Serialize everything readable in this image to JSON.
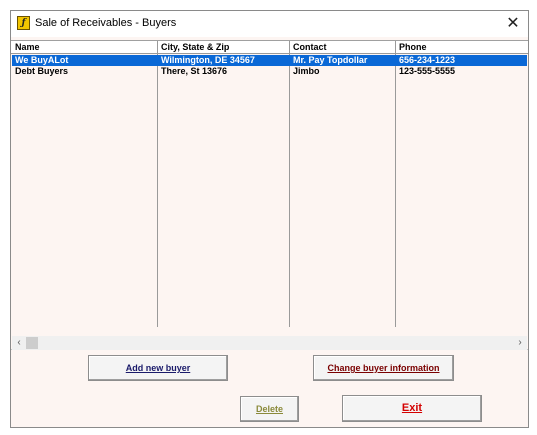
{
  "window": {
    "title": "Sale of Receivables - Buyers",
    "close_glyph": "✕",
    "app_icon_glyph": "ƒ"
  },
  "listview": {
    "columns": [
      "Name",
      "City, State & Zip",
      "Contact",
      "Phone"
    ],
    "rows": [
      {
        "name": "We BuyALot",
        "city": "Wilmington, DE 34567",
        "contact": "Mr. Pay Topdollar",
        "phone": "656-234-1223",
        "selected": true
      },
      {
        "name": "Debt Buyers",
        "city": "There, St 13676",
        "contact": "Jimbo",
        "phone": "123-555-5555",
        "selected": false
      }
    ],
    "scroll_left_glyph": "‹",
    "scroll_right_glyph": "›"
  },
  "buttons": {
    "add": "Add new buyer",
    "change": "Change buyer information",
    "delete": "Delete",
    "exit": "Exit"
  },
  "colors": {
    "selection": "#0a68d6",
    "window_bg": "#fdf5f2",
    "delete_text": "#8a8a3a",
    "exit_text": "#d40000",
    "change_text": "#7a0000",
    "add_text": "#1a1a6a"
  }
}
